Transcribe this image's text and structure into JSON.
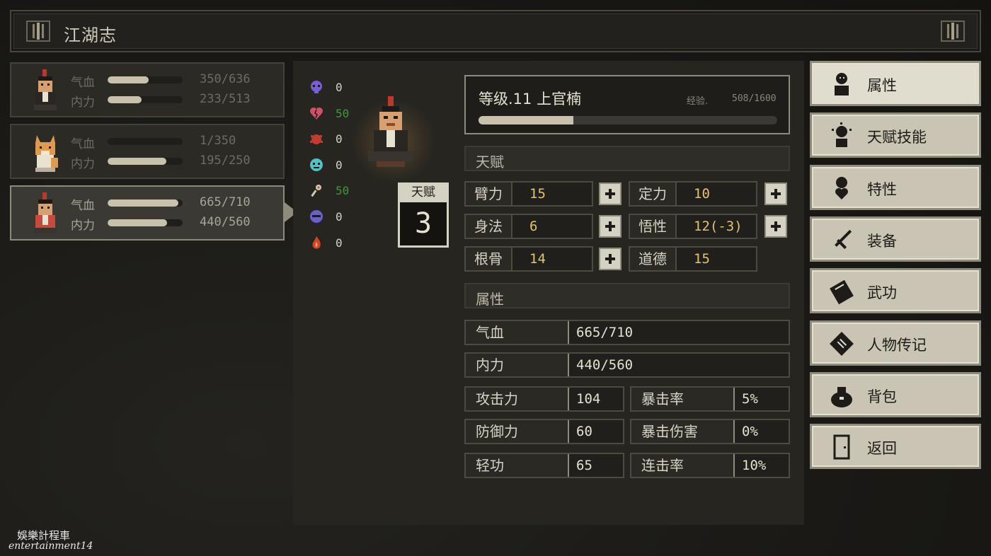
{
  "window": {
    "title": "江湖志"
  },
  "party": [
    {
      "hp_label": "气血",
      "hp_value": "350/636",
      "hp_fraction": 0.55,
      "mp_label": "内力",
      "mp_value": "233/513",
      "mp_fraction": 0.45
    },
    {
      "hp_label": "气血",
      "hp_value": "1/350",
      "hp_fraction": 0.0,
      "mp_label": "内力",
      "mp_value": "195/250",
      "mp_fraction": 0.78
    },
    {
      "hp_label": "气血",
      "hp_value": "665/710",
      "hp_fraction": 0.94,
      "mp_label": "内力",
      "mp_value": "440/560",
      "mp_fraction": 0.79
    }
  ],
  "effects": [
    {
      "icon": "skull-icon",
      "color": "#7b5bd6",
      "value": "0",
      "green": false
    },
    {
      "icon": "broken-heart-icon",
      "color": "#d0506a",
      "value": "50",
      "green": true
    },
    {
      "icon": "bug-icon",
      "color": "#c43a2e",
      "value": "0",
      "green": false
    },
    {
      "icon": "ghost-face-icon",
      "color": "#4fc1c8",
      "value": "0",
      "green": false
    },
    {
      "icon": "flower-icon",
      "color": "#d0c9b0",
      "value": "50",
      "green": true
    },
    {
      "icon": "mask-icon",
      "color": "#6a5fd0",
      "value": "0",
      "green": false
    },
    {
      "icon": "flame-icon",
      "color": "#d0442e",
      "value": "0",
      "green": false
    }
  ],
  "talent_points": {
    "label": "天赋",
    "value": "3"
  },
  "level": {
    "title": "等级.11 上官楠",
    "exp_label": "经验.",
    "exp_value": "508/1600",
    "exp_fraction": 0.3175
  },
  "talent_section": {
    "title": "天赋"
  },
  "talents": [
    {
      "label": "臂力",
      "value": "15"
    },
    {
      "label": "定力",
      "value": "10"
    },
    {
      "label": "身法",
      "value": "6"
    },
    {
      "label": "悟性",
      "value": "12(-3)"
    },
    {
      "label": "根骨",
      "value": "14"
    },
    {
      "label": "道德",
      "value": "15"
    }
  ],
  "attr_section": {
    "title": "属性"
  },
  "attributes": {
    "hp": {
      "label": "气血",
      "value": "665/710"
    },
    "mp": {
      "label": "内力",
      "value": "440/560"
    },
    "atk": {
      "label": "攻击力",
      "value": "104"
    },
    "crit": {
      "label": "暴击率",
      "value": "5%"
    },
    "def": {
      "label": "防御力",
      "value": "60"
    },
    "critdmg": {
      "label": "暴击伤害",
      "value": "0%"
    },
    "agility": {
      "label": "轻功",
      "value": "65"
    },
    "combo": {
      "label": "连击率",
      "value": "10%"
    }
  },
  "menu": [
    {
      "label": "属性",
      "icon": "character-icon",
      "active": true
    },
    {
      "label": "天赋技能",
      "icon": "talent-skill-icon",
      "active": false
    },
    {
      "label": "特性",
      "icon": "trait-icon",
      "active": false
    },
    {
      "label": "装备",
      "icon": "sword-icon",
      "active": false
    },
    {
      "label": "武功",
      "icon": "martial-book-icon",
      "active": false
    },
    {
      "label": "人物传记",
      "icon": "biography-icon",
      "active": false
    },
    {
      "label": "背包",
      "icon": "bag-icon",
      "active": false
    },
    {
      "label": "返回",
      "icon": "door-icon",
      "active": false
    }
  ],
  "watermark": {
    "line1": "娛樂計程車",
    "line2": "entertainment14"
  },
  "colors": {
    "accent_gold": "#e2c56a",
    "green_value": "#3d9a3a",
    "panel": "#262520",
    "menu_bg": "#c9c4b3"
  }
}
